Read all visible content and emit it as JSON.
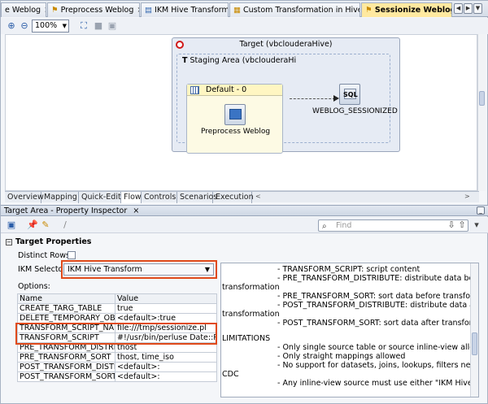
{
  "editor_tabs": [
    {
      "label": "e Weblog",
      "active": false
    },
    {
      "label": "Preprocess Weblog",
      "active": false
    },
    {
      "label": "IKM Hive Transform",
      "active": false
    },
    {
      "label": "Custom Transformation in Hive",
      "active": false
    },
    {
      "label": "Sessionize Weblog",
      "active": true
    }
  ],
  "toolbar": {
    "zoom": "100%"
  },
  "canvas": {
    "target_title": "Target (vbclouderaHive)",
    "staging_title": "Staging Area (vbclouderaHi",
    "default_title": "Default - 0",
    "source_component": "Preprocess Weblog",
    "target_component": "WEBLOG_SESSIONIZED",
    "sql_badge": "SQL"
  },
  "view_tabs": [
    "Overview",
    "Mapping",
    "Quick-Edit",
    "Flow",
    "Controls",
    "Scenarios",
    "Execution"
  ],
  "inspector": {
    "title": "Target Area - Property Inspector",
    "find_placeholder": "Find",
    "section": "Target Properties",
    "distinct_rows_label": "Distinct Rows:",
    "ikm_selector_label": "IKM Selector:",
    "ikm_selector_value": "IKM Hive Transform",
    "options_label": "Options:",
    "table_headers": [
      "Name",
      "Value"
    ],
    "options": [
      {
        "name": "CREATE_TARG_TABLE",
        "value": "true"
      },
      {
        "name": "DELETE_TEMPORARY_OBJE...",
        "value": "<default>:true"
      },
      {
        "name": "TRANSFORM_SCRIPT_NAME",
        "value": "file:///tmp/sessionize.pl"
      },
      {
        "name": "TRANSFORM_SCRIPT",
        "value": "#!/usr/bin/perluse Date::P..."
      },
      {
        "name": "PRE_TRANSFORM_DISTRIB...",
        "value": "thost"
      },
      {
        "name": "PRE_TRANSFORM_SORT",
        "value": "thost, time_iso"
      },
      {
        "name": "POST_TRANSFORM_DISTRI...",
        "value": "<default>:"
      },
      {
        "name": "POST_TRANSFORM_SORT",
        "value": "<default>:"
      }
    ],
    "description_lines": [
      "- TRANSFORM_SCRIPT: script content",
      "- PRE_TRANSFORM_DISTRIBUTE: distribute data before",
      "transformation",
      "- PRE_TRANSFORM_SORT: sort data before transformation",
      "- POST_TRANSFORM_DISTRIBUTE: distribute data after",
      "transformation",
      "- POST_TRANSFORM_SORT: sort data after transformation",
      "LIMITATIONS",
      "- Only single source table or source inline-view allowed",
      "- Only straight mappings allowed",
      "- No support for datasets, joins, lookups, filters neither",
      "CDC",
      "- Any inline-view source must use either \"IKM Hive Control"
    ]
  }
}
